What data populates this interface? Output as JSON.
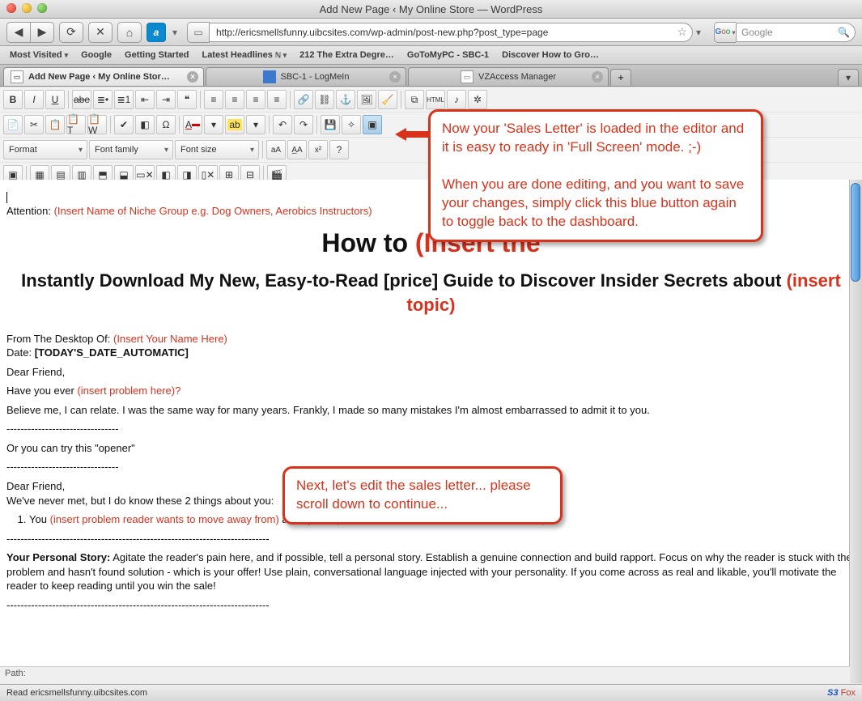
{
  "window": {
    "title": "Add New Page ‹ My Online Store — WordPress"
  },
  "nav": {
    "url": "http://ericsmellsfunny.uibcsites.com/wp-admin/post-new.php?post_type=page",
    "search_placeholder": "Google"
  },
  "bookmarks": [
    "Most Visited",
    "Google",
    "Getting Started",
    "Latest Headlines",
    "212 The Extra Degre…",
    "GoToMyPC - SBC-1",
    "Discover How to Gro…"
  ],
  "tabs": [
    {
      "label": "Add New Page ‹ My Online Stor…",
      "active": true
    },
    {
      "label": "SBC-1 - LogMeIn",
      "active": false
    },
    {
      "label": "VZAccess Manager",
      "active": false
    }
  ],
  "editor": {
    "format": "Format",
    "font_family": "Font family",
    "font_size": "Font size"
  },
  "doc": {
    "attention_label": "Attention:",
    "attention_hint": "(Insert Name of Niche Group e.g. Dog Owners, Aerobics Instructors)",
    "h1a": "How to ",
    "h1b": "(Insert the",
    "h2a": "Instantly Download My New, Easy-to-Read [price] Guide to Discover Insider Secrets about ",
    "h2b": "(insert topic)",
    "desk_label": "From The Desktop Of:",
    "desk_hint": "(Insert Your Name Here)",
    "date_label": "Date:",
    "date_val": "[TODAY'S_DATE_AUTOMATIC]",
    "dear": "Dear Friend,",
    "have_a": "Have you ever ",
    "have_b": "(insert problem here)?",
    "believe": "Believe me, I can relate.  I was the same way for many years.  Frankly, I made so many mistakes I'm almost embarrassed to admit it to you.",
    "dashes_short": "--------------------------------",
    "opener": "Or you can try this \"opener\"",
    "never": "We've never met, but I do know these 2 things about you:",
    "li_a": "You ",
    "li_b": "(insert problem reader wants to move away from)",
    "li_c": " and 2) You ",
    "li_d": "(insert solution reader wants to move toward)",
    "dashes_long": "---------------------------------------------------------------------------",
    "story_label": "Your Personal Story:",
    "story": " Agitate the reader's pain here, and if possible, tell a personal story. Establish a genuine connection and build rapport.  Focus on why the reader is stuck with the problem and hasn't found solution - which is your offer! Use plain, conversational language injected with your personality.  If you come across as real and likable, you'll motivate the reader to keep reading until you win the sale!",
    "path": "Path:"
  },
  "callouts": {
    "c1": "Now your 'Sales Letter' is loaded in the editor and it is easy to ready in 'Full Screen' mode.  ;-)\n\nWhen you are done editing, and you want to save your changes, simply click this blue button again to toggle back to the dashboard.",
    "c2": "Next, let's edit the sales letter... please scroll down to continue..."
  },
  "status": {
    "text": "Read ericsmellsfunny.uibcsites.com",
    "brand": "S3 Fox"
  }
}
